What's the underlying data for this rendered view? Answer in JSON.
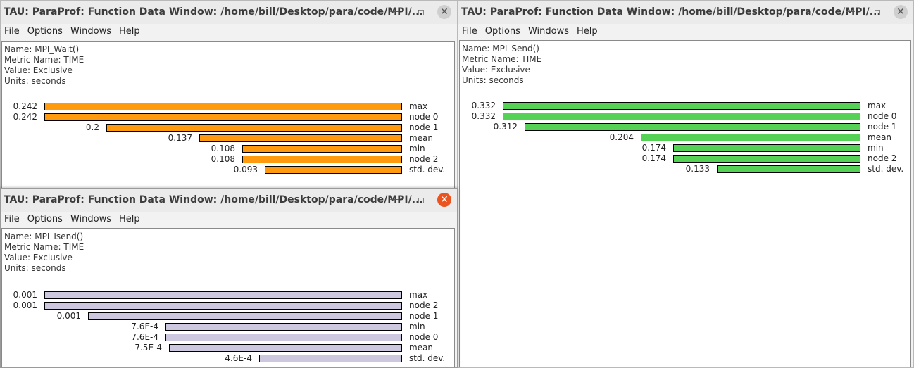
{
  "windows": [
    {
      "id": "win-tl",
      "title": "TAU: ParaProf: Function Data Window: /home/bill/Desktop/para/code/MPI/...",
      "menu": [
        "File",
        "Options",
        "Windows",
        "Help"
      ],
      "info": [
        "Name: MPI_Wait()",
        "Metric Name: TIME",
        "Value: Exclusive",
        "Units: seconds"
      ],
      "bar_color": "#ff9a0f",
      "active": false,
      "chart_data": {
        "type": "bar",
        "orientation": "horizontal",
        "max_value": 0.242,
        "rows": [
          {
            "value_label": "0.242",
            "value": 0.242,
            "label": "max"
          },
          {
            "value_label": "0.242",
            "value": 0.242,
            "label": "node 0"
          },
          {
            "value_label": "0.2",
            "value": 0.2,
            "label": "node 1"
          },
          {
            "value_label": "0.137",
            "value": 0.137,
            "label": "mean"
          },
          {
            "value_label": "0.108",
            "value": 0.108,
            "label": "min"
          },
          {
            "value_label": "0.108",
            "value": 0.108,
            "label": "node 2"
          },
          {
            "value_label": "0.093",
            "value": 0.093,
            "label": "std. dev."
          }
        ]
      }
    },
    {
      "id": "win-tr",
      "title": "TAU: ParaProf: Function Data Window: /home/bill/Desktop/para/code/MPI/...",
      "menu": [
        "File",
        "Options",
        "Windows",
        "Help"
      ],
      "info": [
        "Name: MPI_Send()",
        "Metric Name: TIME",
        "Value: Exclusive",
        "Units: seconds"
      ],
      "bar_color": "#55d155",
      "active": false,
      "chart_data": {
        "type": "bar",
        "orientation": "horizontal",
        "max_value": 0.332,
        "rows": [
          {
            "value_label": "0.332",
            "value": 0.332,
            "label": "max"
          },
          {
            "value_label": "0.332",
            "value": 0.332,
            "label": "node 0"
          },
          {
            "value_label": "0.312",
            "value": 0.312,
            "label": "node 1"
          },
          {
            "value_label": "0.204",
            "value": 0.204,
            "label": "mean"
          },
          {
            "value_label": "0.174",
            "value": 0.174,
            "label": "min"
          },
          {
            "value_label": "0.174",
            "value": 0.174,
            "label": "node 2"
          },
          {
            "value_label": "0.133",
            "value": 0.133,
            "label": "std. dev."
          }
        ]
      }
    },
    {
      "id": "win-bl",
      "title": "TAU: ParaProf: Function Data Window: /home/bill/Desktop/para/code/MPI/...",
      "menu": [
        "File",
        "Options",
        "Windows",
        "Help"
      ],
      "info": [
        "Name: MPI_Isend()",
        "Metric Name: TIME",
        "Value: Exclusive",
        "Units: seconds"
      ],
      "bar_color": "#cdc8e0",
      "active": true,
      "chart_data": {
        "type": "bar",
        "orientation": "horizontal",
        "max_value": 0.00115,
        "rows": [
          {
            "value_label": "0.001",
            "value": 0.00115,
            "label": "max"
          },
          {
            "value_label": "0.001",
            "value": 0.00115,
            "label": "node 2"
          },
          {
            "value_label": "0.001",
            "value": 0.00101,
            "label": "node 1"
          },
          {
            "value_label": "7.6E-4",
            "value": 0.00076,
            "label": "min"
          },
          {
            "value_label": "7.6E-4",
            "value": 0.00076,
            "label": "node 0"
          },
          {
            "value_label": "7.5E-4",
            "value": 0.00075,
            "label": "mean"
          },
          {
            "value_label": "4.6E-4",
            "value": 0.00046,
            "label": "std. dev."
          }
        ]
      }
    }
  ]
}
